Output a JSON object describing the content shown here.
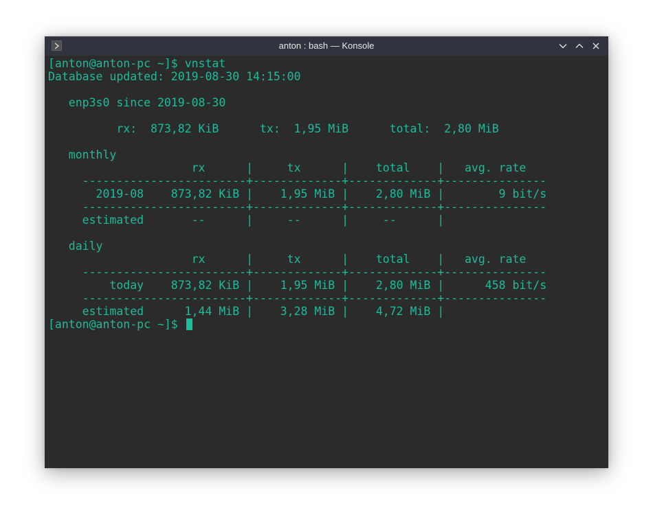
{
  "window": {
    "title": "anton : bash — Konsole"
  },
  "colors": {
    "terminal_bg": "#2b2b2b",
    "terminal_fg": "#1abc9c",
    "titlebar_bg": "#2f343f",
    "titlebar_fg": "#e6e6e6"
  },
  "icons": {
    "app": "konsole-app-icon",
    "minimize": "chevron-down-icon",
    "maximize": "chevron-up-icon",
    "close": "close-icon"
  },
  "terminal": {
    "prompt": "[anton@anton-pc ~]$ ",
    "command": "vnstat",
    "db_updated": "Database updated: 2019-08-30 14:15:00",
    "interface_header": "   enp3s0 since 2019-08-30",
    "totals_line": "          rx:  873,82 KiB      tx:  1,95 MiB      total:  2,80 MiB",
    "monthly": {
      "title": "   monthly",
      "header": "                     rx      |     tx      |    total    |   avg. rate",
      "separator": "     ------------------------+-------------+-------------+---------------",
      "row": "       2019-08    873,82 KiB |    1,95 MiB |    2,80 MiB |        9 bit/s",
      "separator2": "     ------------------------+-------------+-------------+---------------",
      "estimated": "     estimated       --      |     --      |     --      |"
    },
    "daily": {
      "title": "   daily",
      "header": "                     rx      |     tx      |    total    |   avg. rate",
      "separator": "     ------------------------+-------------+-------------+---------------",
      "row": "         today    873,82 KiB |    1,95 MiB |    2,80 MiB |      458 bit/s",
      "separator2": "     ------------------------+-------------+-------------+---------------",
      "estimated": "     estimated      1,44 MiB |    3,28 MiB |    4,72 MiB |"
    },
    "final_prompt": "[anton@anton-pc ~]$ "
  }
}
